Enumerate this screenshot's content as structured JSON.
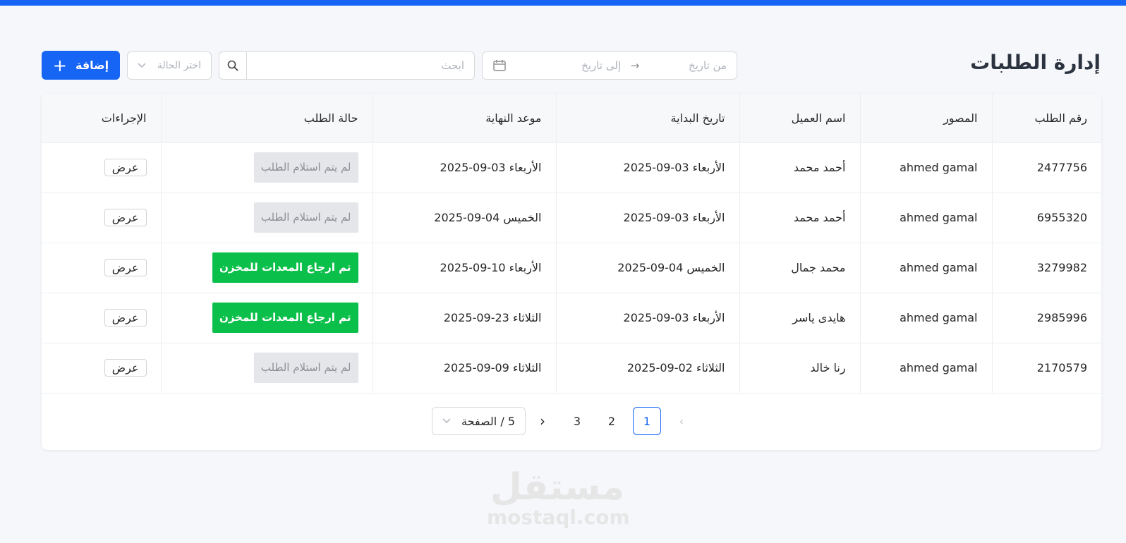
{
  "page": {
    "title": "إدارة الطلبات"
  },
  "toolbar": {
    "date_from_placeholder": "من تاريخ",
    "date_arrow": "→",
    "date_to_placeholder": "إلى تاريخ",
    "search_placeholder": "ابحث",
    "status_placeholder": "اختر الحالة",
    "add_label": "إضافة",
    "add_icon": "+"
  },
  "table": {
    "headers": [
      "رقم الطلب",
      "المصور",
      "اسم العميل",
      "تاريخ البداية",
      "موعد النهاية",
      "حالة الطلب",
      "الإجراءات"
    ],
    "rows": [
      {
        "id": "2477756",
        "photographer": "ahmed gamal",
        "client": "أحمد محمد",
        "start": "الأربعاء 03-09-2025",
        "end": "الأربعاء 03-09-2025",
        "status": "لم يتم استلام الطلب",
        "status_kind": "pending",
        "action": "عرض"
      },
      {
        "id": "6955320",
        "photographer": "ahmed gamal",
        "client": "أحمد محمد",
        "start": "الأربعاء 03-09-2025",
        "end": "الخميس 04-09-2025",
        "status": "لم يتم استلام الطلب",
        "status_kind": "pending",
        "action": "عرض"
      },
      {
        "id": "3279982",
        "photographer": "ahmed gamal",
        "client": "محمد جمال",
        "start": "الخميس 04-09-2025",
        "end": "الأربعاء 10-09-2025",
        "status": "تم ارجاع المعدات للمخزن",
        "status_kind": "done",
        "action": "عرض"
      },
      {
        "id": "2985996",
        "photographer": "ahmed gamal",
        "client": "هايدى ياسر",
        "start": "الأربعاء 03-09-2025",
        "end": "الثلاثاء 23-09-2025",
        "status": "تم ارجاع المعدات للمخزن",
        "status_kind": "done",
        "action": "عرض"
      },
      {
        "id": "2170579",
        "photographer": "ahmed gamal",
        "client": "رنا خالد",
        "start": "الثلاثاء 02-09-2025",
        "end": "الثلاثاء 09-09-2025",
        "status": "لم يتم استلام الطلب",
        "status_kind": "pending",
        "action": "عرض"
      }
    ]
  },
  "pagination": {
    "prev": "‹",
    "pages": [
      "1",
      "2",
      "3"
    ],
    "current": "1",
    "next": "›",
    "page_size": "5 / الصفحة"
  },
  "watermark": {
    "arabic": "مستقل",
    "latin": "mostaql.com"
  },
  "colors": {
    "primary": "#1765f5",
    "success": "#0bc04a",
    "pending_bg": "#e4e6ea"
  },
  "icons": {
    "search": "search-icon",
    "calendar": "calendar-icon",
    "chevron": "chevron-down-icon",
    "plus": "plus-icon"
  }
}
